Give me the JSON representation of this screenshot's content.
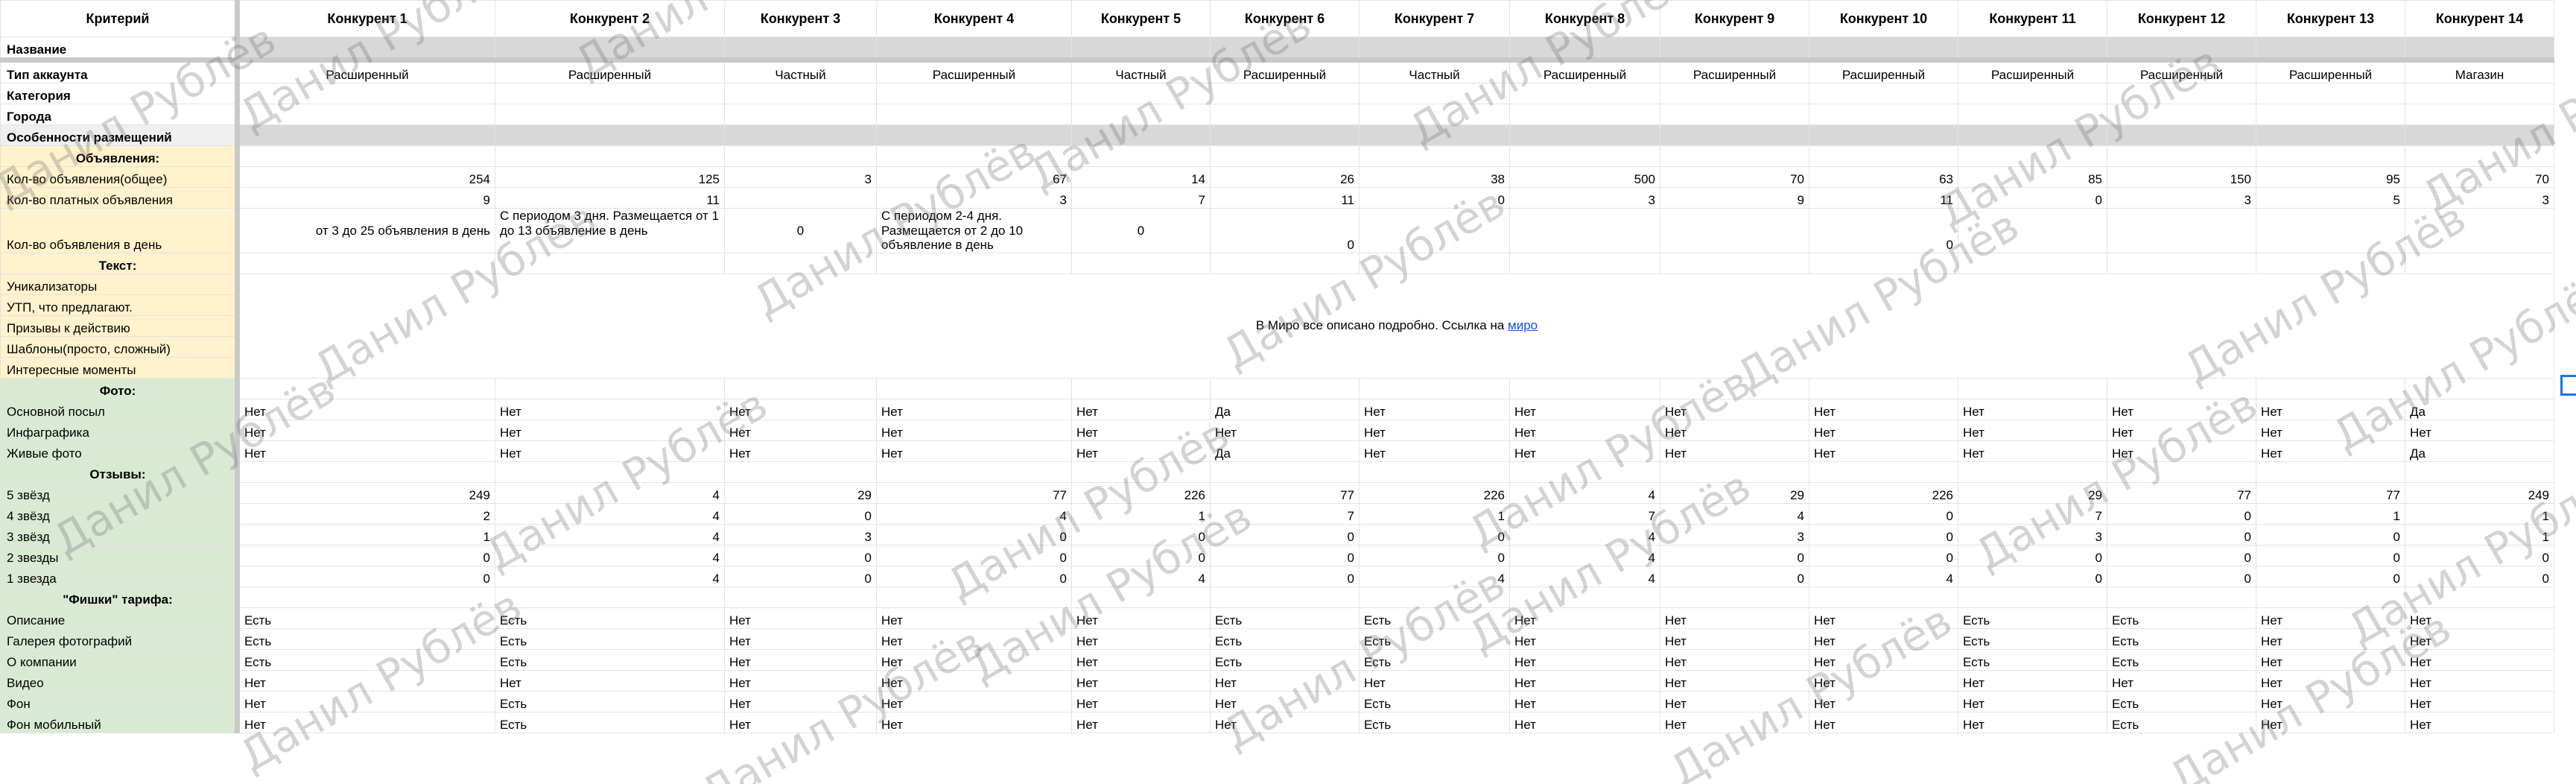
{
  "sheet": {
    "header_label": "Критерий",
    "competitors": [
      "Конкурент 1",
      "Конкурент 2",
      "Конкурент 3",
      "Конкурент 4",
      "Конкурент 5",
      "Конкурент 6",
      "Конкурент 7",
      "Конкурент 8",
      "Конкурент 9",
      "Конкурент 10",
      "Конкурент 11",
      "Конкурент 12",
      "Конкурент 13",
      "Конкурент 14"
    ],
    "rows": {
      "name": "Название",
      "account_type": {
        "label": "Тип аккаунта",
        "values": [
          "Расширенный",
          "Расширенный",
          "Частный",
          "Расширенный",
          "Частный",
          "Расширенный",
          "Частный",
          "Расширенный",
          "Расширенный",
          "Расширенный",
          "Расширенный",
          "Расширенный",
          "Расширенный",
          "Магазин"
        ]
      },
      "category": "Категория",
      "cities": "Города",
      "placement": "Особенности размещений",
      "ads_section": "Объявления:",
      "ads_total": {
        "label": "Кол-во объявления(общее)",
        "values": [
          "254",
          "125",
          "3",
          "67",
          "14",
          "26",
          "38",
          "500",
          "70",
          "63",
          "85",
          "150",
          "95",
          "70"
        ]
      },
      "ads_paid": {
        "label": "Кол-во платных объявления",
        "values": [
          "9",
          "11",
          "",
          "3",
          "7",
          "11",
          "0",
          "3",
          "9",
          "11",
          "0",
          "3",
          "5",
          "3"
        ]
      },
      "ads_per_day": {
        "label": "Кол-во объявления в день",
        "c1": "от 3 до 25 объявления в день",
        "c2": "С периодом 3 дня. Размещается от 1 до 13 объявление в день",
        "c3": "0",
        "c4": "С периодом 2-4 дня. Размещается от 2 до 10 объявление в день",
        "c5": "0",
        "c6": "0",
        "c10": "0"
      },
      "text_section": "Текст:",
      "unique": "Уникализаторы",
      "usp": "УТП, что предлагают.",
      "cta": "Призывы к действию",
      "templates": "Шаблоны(просто, сложный)",
      "interesting": "Интересные моменты",
      "miro_note": "В Миро все описано подробно. Ссылка на",
      "miro_link": "миро",
      "photo_section": "Фото:",
      "main_message": {
        "label": "Основной посыл",
        "values": [
          "Нет",
          "Нет",
          "Нет",
          "Нет",
          "Нет",
          "Да",
          "Нет",
          "Нет",
          "Нет",
          "Нет",
          "Нет",
          "Нет",
          "Нет",
          "Да"
        ]
      },
      "infographic": {
        "label": "Инфаграфика",
        "values": [
          "Нет",
          "Нет",
          "Нет",
          "Нет",
          "Нет",
          "Нет",
          "Нет",
          "Нет",
          "Нет",
          "Нет",
          "Нет",
          "Нет",
          "Нет",
          "Нет"
        ]
      },
      "live_photo": {
        "label": "Живые фото",
        "values": [
          "Нет",
          "Нет",
          "Нет",
          "Нет",
          "Нет",
          "Да",
          "Нет",
          "Нет",
          "Нет",
          "Нет",
          "Нет",
          "Нет",
          "Нет",
          "Да"
        ]
      },
      "reviews_section": "Отзывы:",
      "stars5": {
        "label": "5 звёзд",
        "values": [
          "249",
          "4",
          "29",
          "77",
          "226",
          "77",
          "226",
          "4",
          "29",
          "226",
          "29",
          "77",
          "77",
          "249"
        ]
      },
      "stars4": {
        "label": "4 звёзд",
        "values": [
          "2",
          "4",
          "0",
          "4",
          "1",
          "7",
          "1",
          "7",
          "4",
          "0",
          "7",
          "0",
          "1",
          "1"
        ]
      },
      "stars3": {
        "label": "3 звёзд",
        "values": [
          "1",
          "4",
          "3",
          "0",
          "0",
          "0",
          "0",
          "4",
          "3",
          "0",
          "3",
          "0",
          "0",
          "1"
        ]
      },
      "stars2": {
        "label": "2 звезды",
        "values": [
          "0",
          "4",
          "0",
          "0",
          "0",
          "0",
          "0",
          "4",
          "0",
          "0",
          "0",
          "0",
          "0",
          "0"
        ]
      },
      "stars1": {
        "label": "1 звезда",
        "values": [
          "0",
          "4",
          "0",
          "0",
          "4",
          "0",
          "4",
          "4",
          "0",
          "4",
          "0",
          "0",
          "0",
          "0"
        ]
      },
      "features_section": "\"Фишки\" тарифа:",
      "description": {
        "label": "Описание",
        "values": [
          "Есть",
          "Есть",
          "Нет",
          "Нет",
          "Нет",
          "Есть",
          "Есть",
          "Нет",
          "Нет",
          "Нет",
          "Есть",
          "Есть",
          "Нет",
          "Нет"
        ]
      },
      "gallery": {
        "label": "Галерея фотографий",
        "values": [
          "Есть",
          "Есть",
          "Нет",
          "Нет",
          "Нет",
          "Есть",
          "Есть",
          "Нет",
          "Нет",
          "Нет",
          "Есть",
          "Есть",
          "Нет",
          "Нет"
        ]
      },
      "about": {
        "label": "О компании",
        "values": [
          "Есть",
          "Есть",
          "Нет",
          "Нет",
          "Нет",
          "Есть",
          "Есть",
          "Нет",
          "Нет",
          "Нет",
          "Есть",
          "Есть",
          "Нет",
          "Нет"
        ]
      },
      "video": {
        "label": "Видео",
        "values": [
          "Нет",
          "Нет",
          "Нет",
          "Нет",
          "Нет",
          "Нет",
          "Нет",
          "Нет",
          "Нет",
          "Нет",
          "Нет",
          "Нет",
          "Нет",
          "Нет"
        ]
      },
      "background": {
        "label": "Фон",
        "values": [
          "Нет",
          "Есть",
          "Нет",
          "Нет",
          "Нет",
          "Нет",
          "Есть",
          "Нет",
          "Нет",
          "Нет",
          "Нет",
          "Есть",
          "Нет",
          "Нет"
        ]
      },
      "background_mobile": {
        "label": "Фон мобильный",
        "values": [
          "Нет",
          "Есть",
          "Нет",
          "Нет",
          "Нет",
          "Нет",
          "Есть",
          "Нет",
          "Нет",
          "Нет",
          "Нет",
          "Есть",
          "Нет",
          "Нет"
        ]
      }
    }
  },
  "watermark_text": "Данил Рублёв",
  "colors": {
    "yellow": "#fff2cc",
    "green": "#d9ead3",
    "gray_bar": "#d8d8d8",
    "link": "#1155cc",
    "selection": "#1a73e8"
  }
}
